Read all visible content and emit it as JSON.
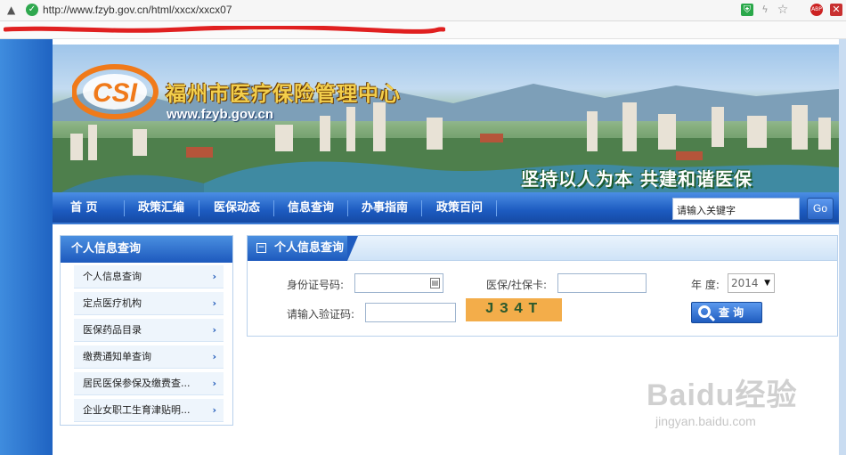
{
  "browser": {
    "url": "http://www.fzyb.gov.cn/html/xxcx/xxcx07"
  },
  "banner": {
    "site_title": "福州市医疗保险管理中心",
    "site_url": "www.fzyb.gov.cn",
    "slogan": "坚持以人为本 共建和谐医保",
    "logo_text": "CSI"
  },
  "nav": {
    "items": [
      "首 页",
      "政策汇编",
      "医保动态",
      "信息查询",
      "办事指南",
      "政策百问"
    ],
    "search_placeholder": "请输入关键字",
    "go_label": "Go"
  },
  "sidebar": {
    "title": "个人信息查询",
    "items": [
      {
        "label": "个人信息查询"
      },
      {
        "label": "定点医疗机构"
      },
      {
        "label": "医保药品目录"
      },
      {
        "label": "缴费通知单查询"
      },
      {
        "label": "居民医保参保及缴费查..."
      },
      {
        "label": "企业女职工生育津贴明..."
      }
    ]
  },
  "panel": {
    "title": "个人信息查询",
    "id_label": "身份证号码:",
    "card_label": "医保/社保卡:",
    "year_label": "年 度:",
    "year_value": "2014",
    "captcha_label": "请输入验证码:",
    "captcha_text": "J34T",
    "query_label": "查 询"
  },
  "watermark": {
    "main": "Baidu经验",
    "sub": "jingyan.baidu.com"
  },
  "colors": {
    "nav_blue": "#1d5bc0",
    "title_gold": "#f3cf4c",
    "captcha_bg": "#f3ad4a"
  }
}
